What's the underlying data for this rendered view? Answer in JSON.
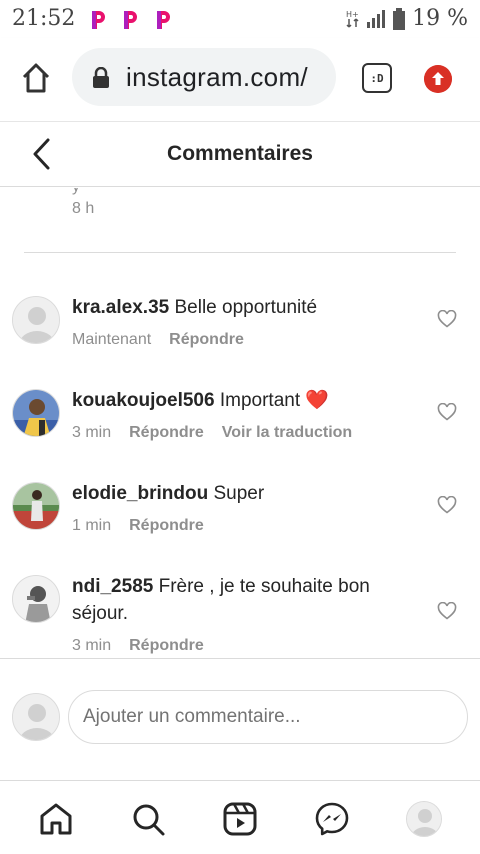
{
  "status_bar": {
    "time": "21:52",
    "battery_text": "19 %",
    "app_icons": [
      "p-app-icon",
      "p-app-icon",
      "p-app-icon"
    ],
    "network_label": "H+"
  },
  "browser": {
    "url": "instagram.com/",
    "tab_label": ":D"
  },
  "header": {
    "title": "Commentaires"
  },
  "previous_comment": {
    "fragment": "y",
    "time": "8 h"
  },
  "comments": [
    {
      "username": "kra.alex.35",
      "text": "Belle opportunité",
      "time": "Maintenant",
      "reply_label": "Répondre",
      "avatar": "default-avatar"
    },
    {
      "username": "kouakoujoel506",
      "text": "Important ❤️",
      "time": "3 min",
      "reply_label": "Répondre",
      "translate_label": "Voir la traduction",
      "avatar": "photo-avatar"
    },
    {
      "username": "elodie_brindou",
      "text": "Super",
      "time": "1 min",
      "reply_label": "Répondre",
      "avatar": "photo-avatar"
    },
    {
      "username": "ndi_2585",
      "text": "Frère , je te souhaite bon séjour.",
      "time": "3 min",
      "reply_label": "Répondre",
      "avatar": "photo-avatar"
    }
  ],
  "add_comment": {
    "placeholder": "Ajouter un commentaire..."
  },
  "colors": {
    "text_primary": "#262626",
    "text_secondary": "#8e8e8e",
    "border": "#dbdbdb",
    "heart_red": "#ed4956",
    "update_red": "#d93025"
  }
}
